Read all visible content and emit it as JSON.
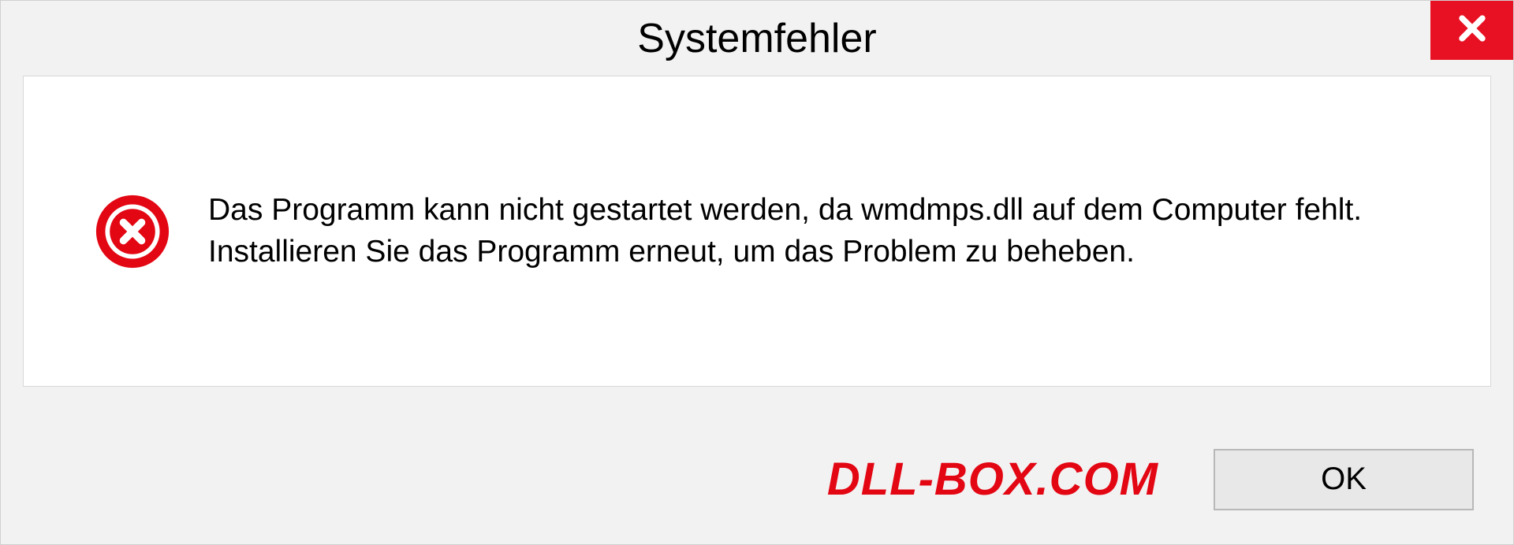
{
  "dialog": {
    "title": "Systemfehler",
    "message": "Das Programm kann nicht gestartet werden, da wmdmps.dll auf dem Computer fehlt. Installieren Sie das Programm erneut, um das Problem zu beheben.",
    "ok_label": "OK"
  },
  "watermark": "DLL-BOX.COM",
  "colors": {
    "close_bg": "#e81123",
    "error_icon": "#e30613",
    "watermark": "#e30613"
  }
}
